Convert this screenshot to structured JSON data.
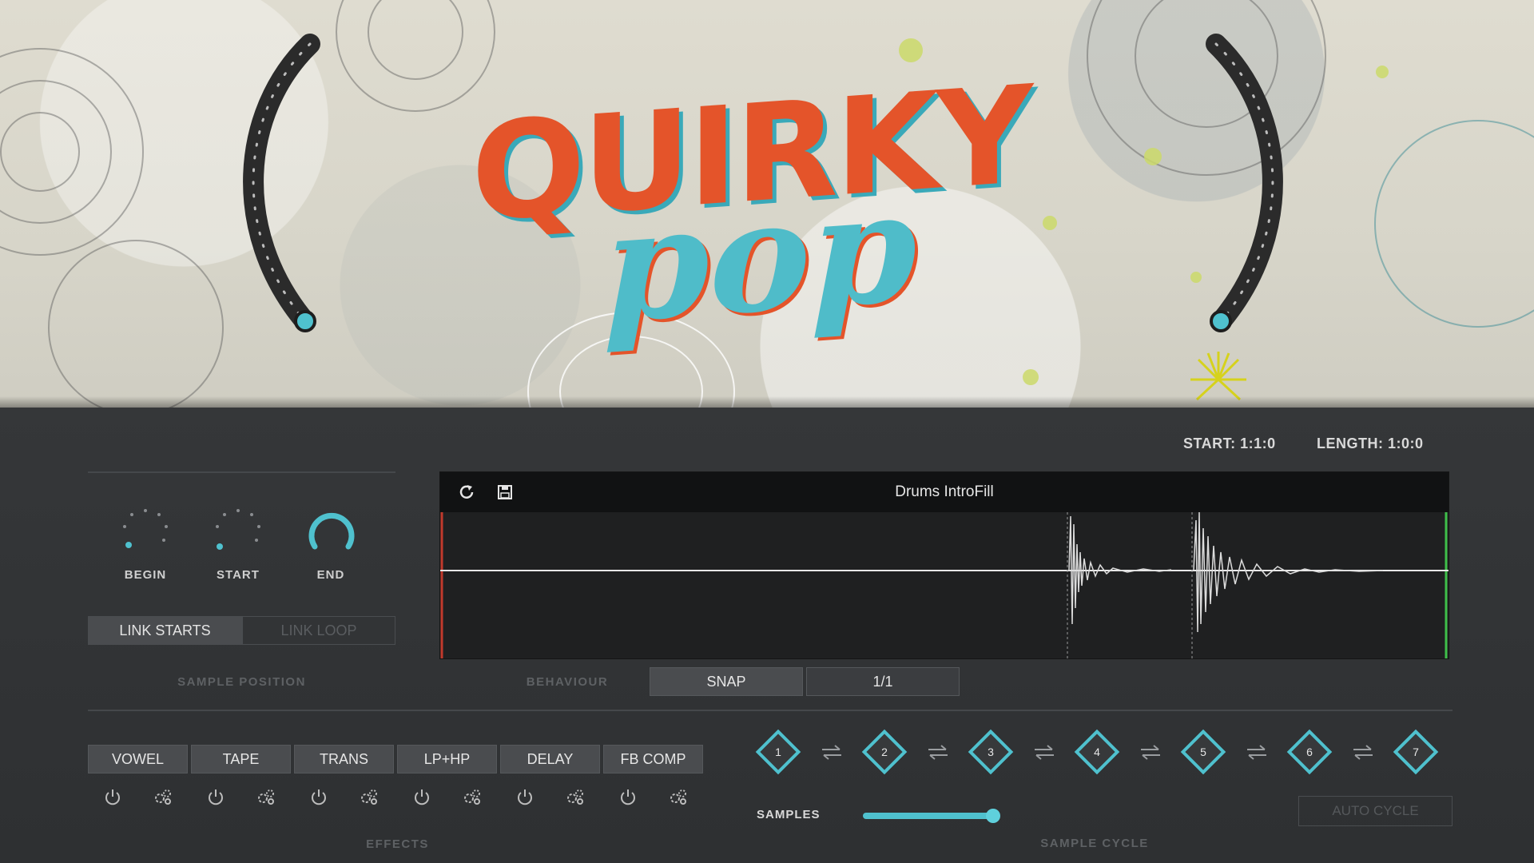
{
  "banner": {
    "logo_top": "QUIRKY",
    "logo_bottom": "pop"
  },
  "colors": {
    "accent": "#4fc1ce",
    "logo_orange": "#e4542a",
    "logo_teal": "#4fbcc9",
    "panel": "#2f3133"
  },
  "info": {
    "start": "START: 1:1:0",
    "length": "LENGTH: 1:0:0"
  },
  "knobs": [
    {
      "label": "BEGIN"
    },
    {
      "label": "START"
    },
    {
      "label": "END"
    }
  ],
  "link": {
    "starts": "LINK STARTS",
    "loop": "LINK LOOP"
  },
  "sample_position_label": "SAMPLE POSITION",
  "waveform": {
    "title": "Drums IntroFill",
    "icons": [
      "refresh-icon",
      "save-icon"
    ]
  },
  "behaviour": {
    "label": "BEHAVIOUR",
    "snap": "SNAP",
    "division": "1/1"
  },
  "effects": {
    "label": "EFFECTS",
    "buttons": [
      "VOWEL",
      "TAPE",
      "TRANS",
      "LP+HP",
      "DELAY",
      "FB COMP"
    ]
  },
  "sample_cycle": {
    "label": "SAMPLE CYCLE",
    "slots": [
      "1",
      "2",
      "3",
      "4",
      "5",
      "6",
      "7"
    ],
    "samples_label": "SAMPLES",
    "auto_cycle": "AUTO CYCLE"
  }
}
